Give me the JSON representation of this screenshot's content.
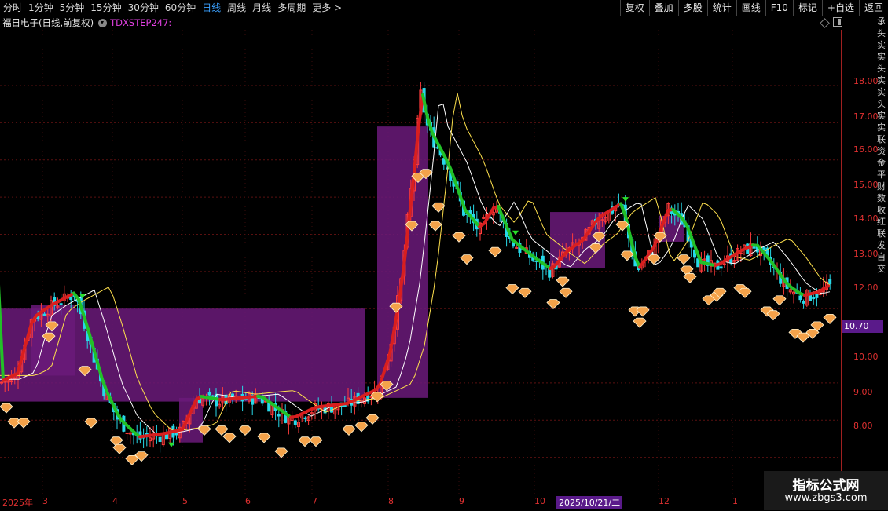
{
  "toolbar": {
    "periods": [
      "分时",
      "1分钟",
      "5分钟",
      "15分钟",
      "30分钟",
      "60分钟",
      "日线",
      "周线",
      "月线",
      "多周期",
      "更多 >"
    ],
    "active_period": "日线",
    "tools": [
      "复权",
      "叠加",
      "多股",
      "统计",
      "画线",
      "F10",
      "标记",
      "+自选",
      "返回"
    ]
  },
  "info": {
    "stock": "福日电子(日线,前复权)",
    "indicator": "TDXSTEP247:"
  },
  "axis": {
    "price_labels": [
      "18.00",
      "17.00",
      "16.00",
      "15.00",
      "14.00",
      "13.00",
      "12.00",
      "10.00",
      "9.00",
      "8.00"
    ],
    "current_price": "10.70"
  },
  "timeline": {
    "months": [
      "2025年",
      "3",
      "4",
      "5",
      "6",
      "7",
      "8",
      "9",
      "10",
      "12",
      "1"
    ],
    "date_tag": "2025/10/21/二"
  },
  "side_text": "承头实实头实实头实实联资金平财数收红联发自交",
  "watermark": {
    "title": "指标公式网",
    "url": "www.zbgs3.com"
  },
  "chart_data": {
    "type": "candlestick",
    "title": "",
    "ylim": [
      7.0,
      19.5
    ],
    "y_ticks": [
      8,
      9,
      10,
      12,
      13,
      14,
      15,
      16,
      17,
      18
    ],
    "colors": {
      "up": "#ff3b3b",
      "down": "#27d8e8",
      "ma_white": "#ffffff",
      "ma_yellow": "#ffe14d",
      "step_up": "#d81f1f",
      "step_down": "#22c028",
      "fill": "#6b1a7a",
      "diamond": "#f4a24a"
    }
  }
}
